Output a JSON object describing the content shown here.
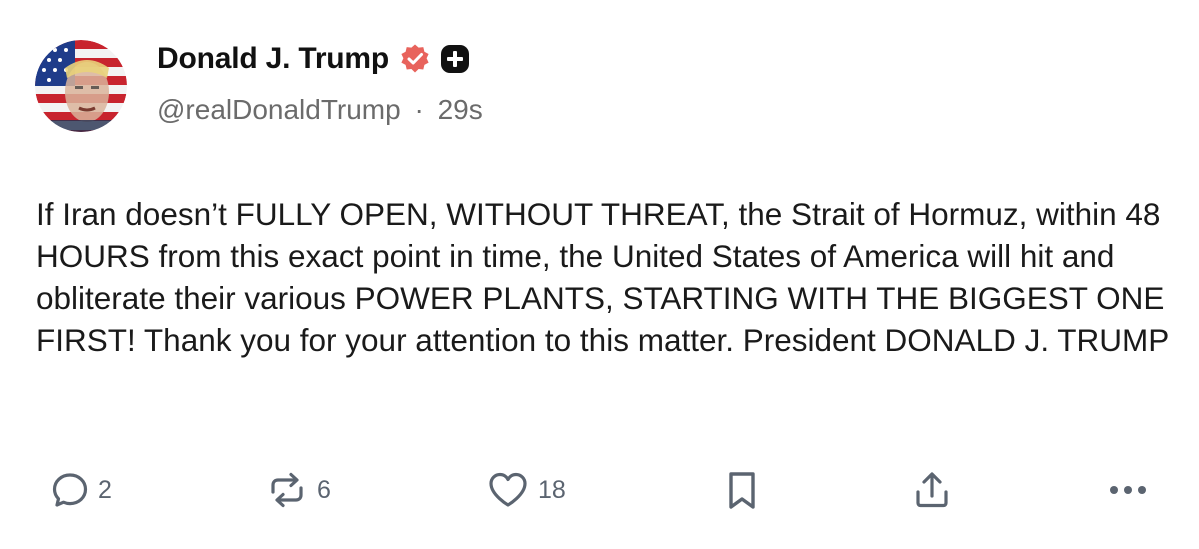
{
  "author": {
    "display_name": "Donald J. Trump",
    "handle": "@realDonaldTrump",
    "separator": "·",
    "time_ago": "29s",
    "verified_color": "#e8635c"
  },
  "post": {
    "text": "If Iran doesn’t FULLY OPEN, WITHOUT THREAT, the Strait of Hormuz, within 48 HOURS from this exact point in time, the United States of America will hit and obliterate their various POWER PLANTS, STARTING WITH THE BIGGEST ONE FIRST! Thank you for your attention to this matter. President DONALD J. TRUMP"
  },
  "actions": {
    "replies": "2",
    "reposts": "6",
    "likes": "18",
    "icons": [
      "reply-icon",
      "repost-icon",
      "like-icon",
      "bookmark-icon",
      "share-icon",
      "more-icon"
    ]
  },
  "colors": {
    "text": "#1a1a1a",
    "muted": "#6b6b6b",
    "icon": "#5b6470"
  }
}
